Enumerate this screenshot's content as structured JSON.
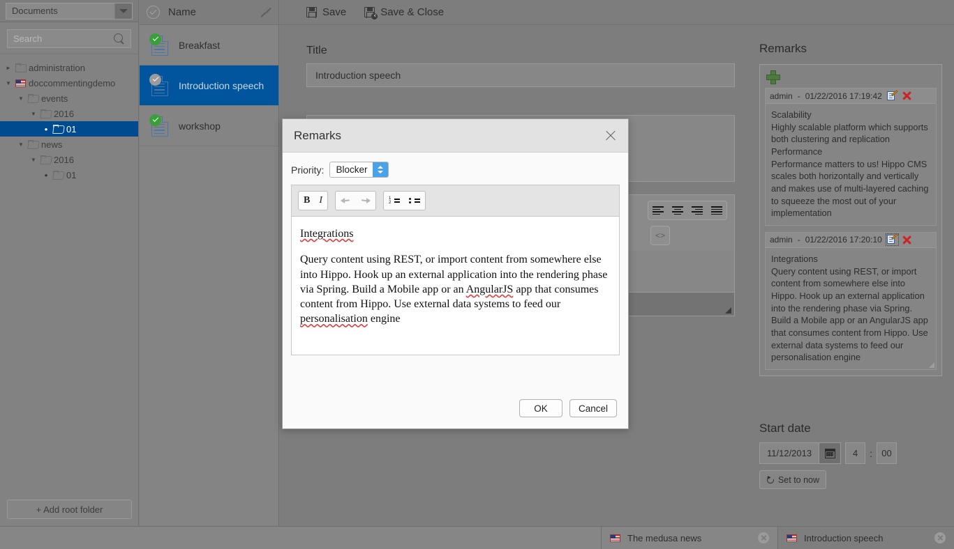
{
  "sidebar": {
    "selector_value": "Documents",
    "search_placeholder": "Search",
    "tree": [
      {
        "label": "administration",
        "depth": 0,
        "twisty": "collapsed",
        "icon": "folder-closed",
        "selected": false
      },
      {
        "label": "doccommentingdemo",
        "depth": 0,
        "twisty": "expanded",
        "icon": "flag",
        "selected": false
      },
      {
        "label": "events",
        "depth": 1,
        "twisty": "expanded",
        "icon": "folder-open",
        "selected": false
      },
      {
        "label": "2016",
        "depth": 2,
        "twisty": "expanded",
        "icon": "folder-open",
        "selected": false
      },
      {
        "label": "01",
        "depth": 3,
        "twisty": "leaf",
        "icon": "folder-open",
        "selected": true
      },
      {
        "label": "news",
        "depth": 1,
        "twisty": "expanded",
        "icon": "folder-open",
        "selected": false
      },
      {
        "label": "2016",
        "depth": 2,
        "twisty": "expanded",
        "icon": "folder-open",
        "selected": false
      },
      {
        "label": "01",
        "depth": 3,
        "twisty": "leaf",
        "icon": "folder-open",
        "selected": false
      }
    ],
    "add_root_label": "+ Add root folder"
  },
  "doclist": {
    "header": "Name",
    "rows": [
      {
        "label": "Breakfast",
        "badge": "green",
        "selected": false
      },
      {
        "label": "Introduction speech",
        "badge": "gray",
        "selected": true
      },
      {
        "label": "workshop",
        "badge": "green",
        "selected": false
      }
    ]
  },
  "toolbar": {
    "save_label": "Save",
    "save_close_label": "Save & Close"
  },
  "editor": {
    "title_label": "Title",
    "title_value": "Introduction speech"
  },
  "remarks_panel": {
    "title": "Remarks",
    "items": [
      {
        "author": "admin",
        "timestamp": "01/22/2016 17:19:42",
        "body": "Scalability\nHighly scalable platform which supports\nboth clustering and replication\nPerformance\nPerformance matters to us! Hippo CMS  scales both  horizontally and vertically and makes use of  multi-layered caching to squeeze the most out of your implementation",
        "edit_focused": false
      },
      {
        "author": "admin",
        "timestamp": "01/22/2016 17:20:10",
        "body": "Integrations\nQuery content using REST, or import content from somewhere else into Hippo. Hook up an external application into the rendering phase via Spring. Build a Mobile app or an AngularJS app that consumes content from Hippo. Use external data systems to feed our personalisation engine",
        "edit_focused": true
      }
    ]
  },
  "start_date": {
    "title": "Start date",
    "date_value": "11/12/2013",
    "hour_value": "4",
    "separator": ":",
    "minute_value": "00",
    "set_now_label": "Set to now"
  },
  "dialog": {
    "title": "Remarks",
    "priority_label": "Priority:",
    "priority_value": "Blocker",
    "body_heading": "Integrations",
    "body_text_1": "Query content using REST, or import content from somewhere else into Hippo. Hook up an external application into the rendering phase via Spring. Build a Mobile app or an ",
    "body_spell_1": "AngularJS",
    "body_text_2": " app that consumes content from Hippo. Use external data systems to feed our ",
    "body_spell_2": "personalisation",
    "body_text_3": " engine",
    "ok_label": "OK",
    "cancel_label": "Cancel"
  },
  "taskbar": {
    "tabs": [
      {
        "title": "The medusa news",
        "active": false
      },
      {
        "title": "Introduction speech",
        "active": true
      }
    ]
  },
  "colors": {
    "selection_blue": "#00559c",
    "tree_selection_blue": "#004a8f",
    "stepper_blue": "#4aa3e8",
    "badge_green": "#3a9e3a",
    "delete_red": "#cf2222"
  }
}
